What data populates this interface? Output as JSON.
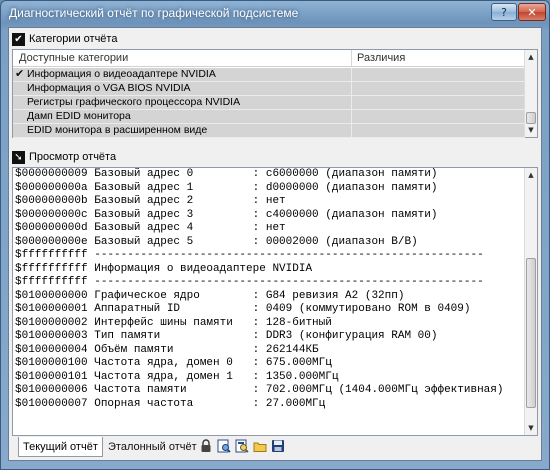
{
  "window": {
    "title": "Диагностический отчёт по графической подсистеме",
    "help_label": "?",
    "close_label": "✕"
  },
  "categories": {
    "header": "Категории отчёта",
    "col_available": "Доступные категории",
    "col_diff": "Различия",
    "items": [
      {
        "label": "Информация о видеоадаптере NVIDIA",
        "checked": true
      },
      {
        "label": "Информация о VGA BIOS NVIDIA",
        "checked": false
      },
      {
        "label": "Регистры графического процессора NVIDIA",
        "checked": false
      },
      {
        "label": "Дамп EDID монитора",
        "checked": false
      },
      {
        "label": "EDID монитора в расширенном виде",
        "checked": false
      }
    ]
  },
  "report": {
    "header": "Просмотр отчёта",
    "lines": [
      "$0000000009 Базовый адрес 0         : c6000000 (диапазон памяти)",
      "$000000000a Базовый адрес 1         : d0000000 (диапазон памяти)",
      "$000000000b Базовый адрес 2         : нет",
      "$000000000c Базовый адрес 3         : c4000000 (диапазон памяти)",
      "$000000000d Базовый адрес 4         : нет",
      "$000000000e Базовый адрес 5         : 00002000 (диапазон В/В)",
      "$ffffffffff -----------------------------------------------------------",
      "$ffffffffff Информация о видеоадаптере NVIDIA",
      "$ffffffffff -----------------------------------------------------------",
      "$0100000000 Графическое ядро        : G84 ревизия A2 (32пп)",
      "$0100000001 Аппаратный ID           : 0409 (коммутировано ROM в 0409)",
      "$0100000002 Интерфейс шины памяти   : 128-битный",
      "$0100000003 Тип памяти              : DDR3 (конфигурация RAM 00)",
      "$0100000004 Объём памяти            : 262144КБ",
      "$0100000100 Частота ядра, домен 0   : 675.000МГц",
      "$0100000101 Частота ядра, домен 1   : 1350.000МГц",
      "$0100000006 Частота памяти          : 702.000МГц (1404.000МГц эффективная)",
      "$0100000007 Опорная частота         : 27.000МГц"
    ]
  },
  "tabs": {
    "current": "Текущий отчёт",
    "reference": "Эталонный отчёт"
  },
  "toolbar": {
    "icons": [
      "lock-icon",
      "view-icon",
      "compare-icon",
      "open-folder-icon",
      "save-icon"
    ]
  },
  "colors": {
    "title_bar": "#6d93bb",
    "selected_row": "#d4d4d4",
    "panel_bg": "#ffffff"
  }
}
